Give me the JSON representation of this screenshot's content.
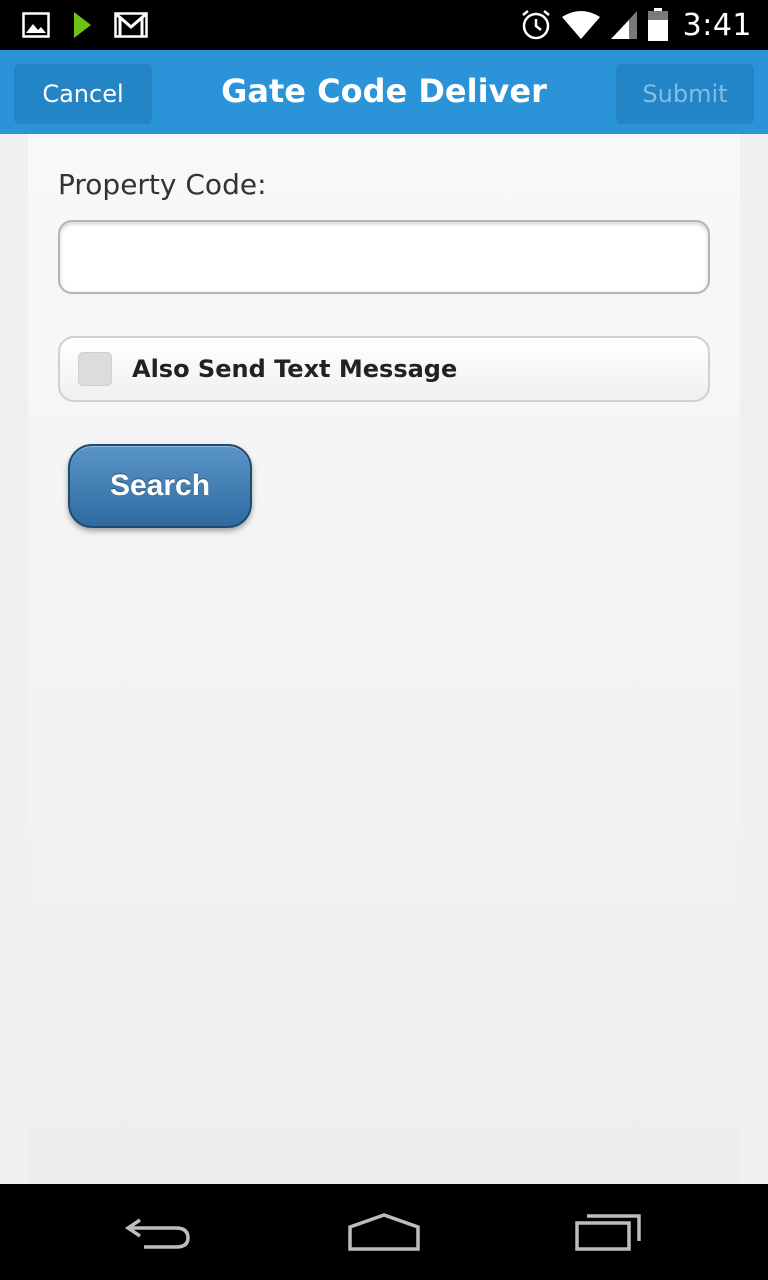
{
  "status_bar": {
    "time": "3:41",
    "left_icons": [
      "image-icon",
      "play-store-icon",
      "gmail-icon"
    ],
    "right_icons": [
      "alarm-icon",
      "wifi-icon",
      "signal-icon",
      "battery-icon"
    ]
  },
  "header": {
    "cancel_label": "Cancel",
    "title": "Gate Code Deliver",
    "submit_label": "Submit"
  },
  "form": {
    "property_code_label": "Property Code:",
    "property_code_value": "",
    "also_send_text_label": "Also Send Text Message",
    "also_send_text_checked": false,
    "search_label": "Search"
  },
  "nav_bar": {
    "icons": [
      "back-icon",
      "home-icon",
      "recents-icon"
    ]
  },
  "colors": {
    "header_bg": "#2b93d8",
    "header_button_bg": "#2384c6",
    "submit_disabled_text": "#82bde6",
    "search_button": "#3d78ad"
  }
}
